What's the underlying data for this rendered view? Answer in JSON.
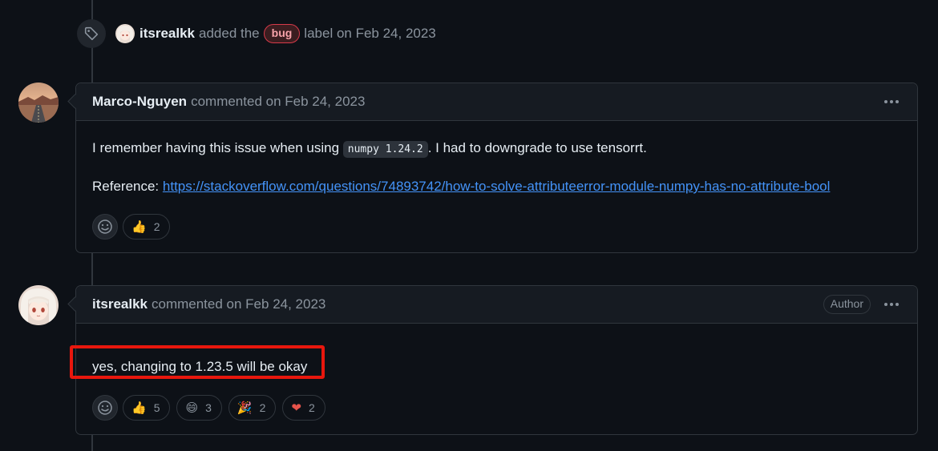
{
  "label_event": {
    "actor": "itsrealkk",
    "action": "added the",
    "label_name": "bug",
    "suffix": "label on Feb 24, 2023",
    "icon": "tag-icon"
  },
  "comments": [
    {
      "author": "Marco-Nguyen",
      "meta": "commented on Feb 24, 2023",
      "body": {
        "line1_before": "I remember having this issue when using",
        "code": "numpy 1.24.2",
        "line1_after": ". I had to downgrade to use tensorrt.",
        "ref_label": "Reference:",
        "ref_url": "https://stackoverflow.com/questions/74893742/how-to-solve-attributeerror-module-numpy-has-no-attribute-bool"
      },
      "reactions": [
        {
          "emoji": "👍",
          "count": "2"
        }
      ]
    },
    {
      "author": "itsrealkk",
      "meta": "commented on Feb 24, 2023",
      "badge": "Author",
      "body": {
        "text": "yes, changing to 1.23.5 will be okay"
      },
      "reactions": [
        {
          "emoji": "👍",
          "count": "5"
        },
        {
          "emoji": "😄",
          "count": "3"
        },
        {
          "emoji": "🎉",
          "count": "2"
        },
        {
          "emoji": "❤",
          "count": "2"
        }
      ]
    }
  ],
  "colors": {
    "background": "#0d1117",
    "header": "#161b22",
    "border": "#30363d",
    "link": "#4493f8",
    "bug_label": "#d73a4a",
    "highlight": "#e8170d"
  }
}
